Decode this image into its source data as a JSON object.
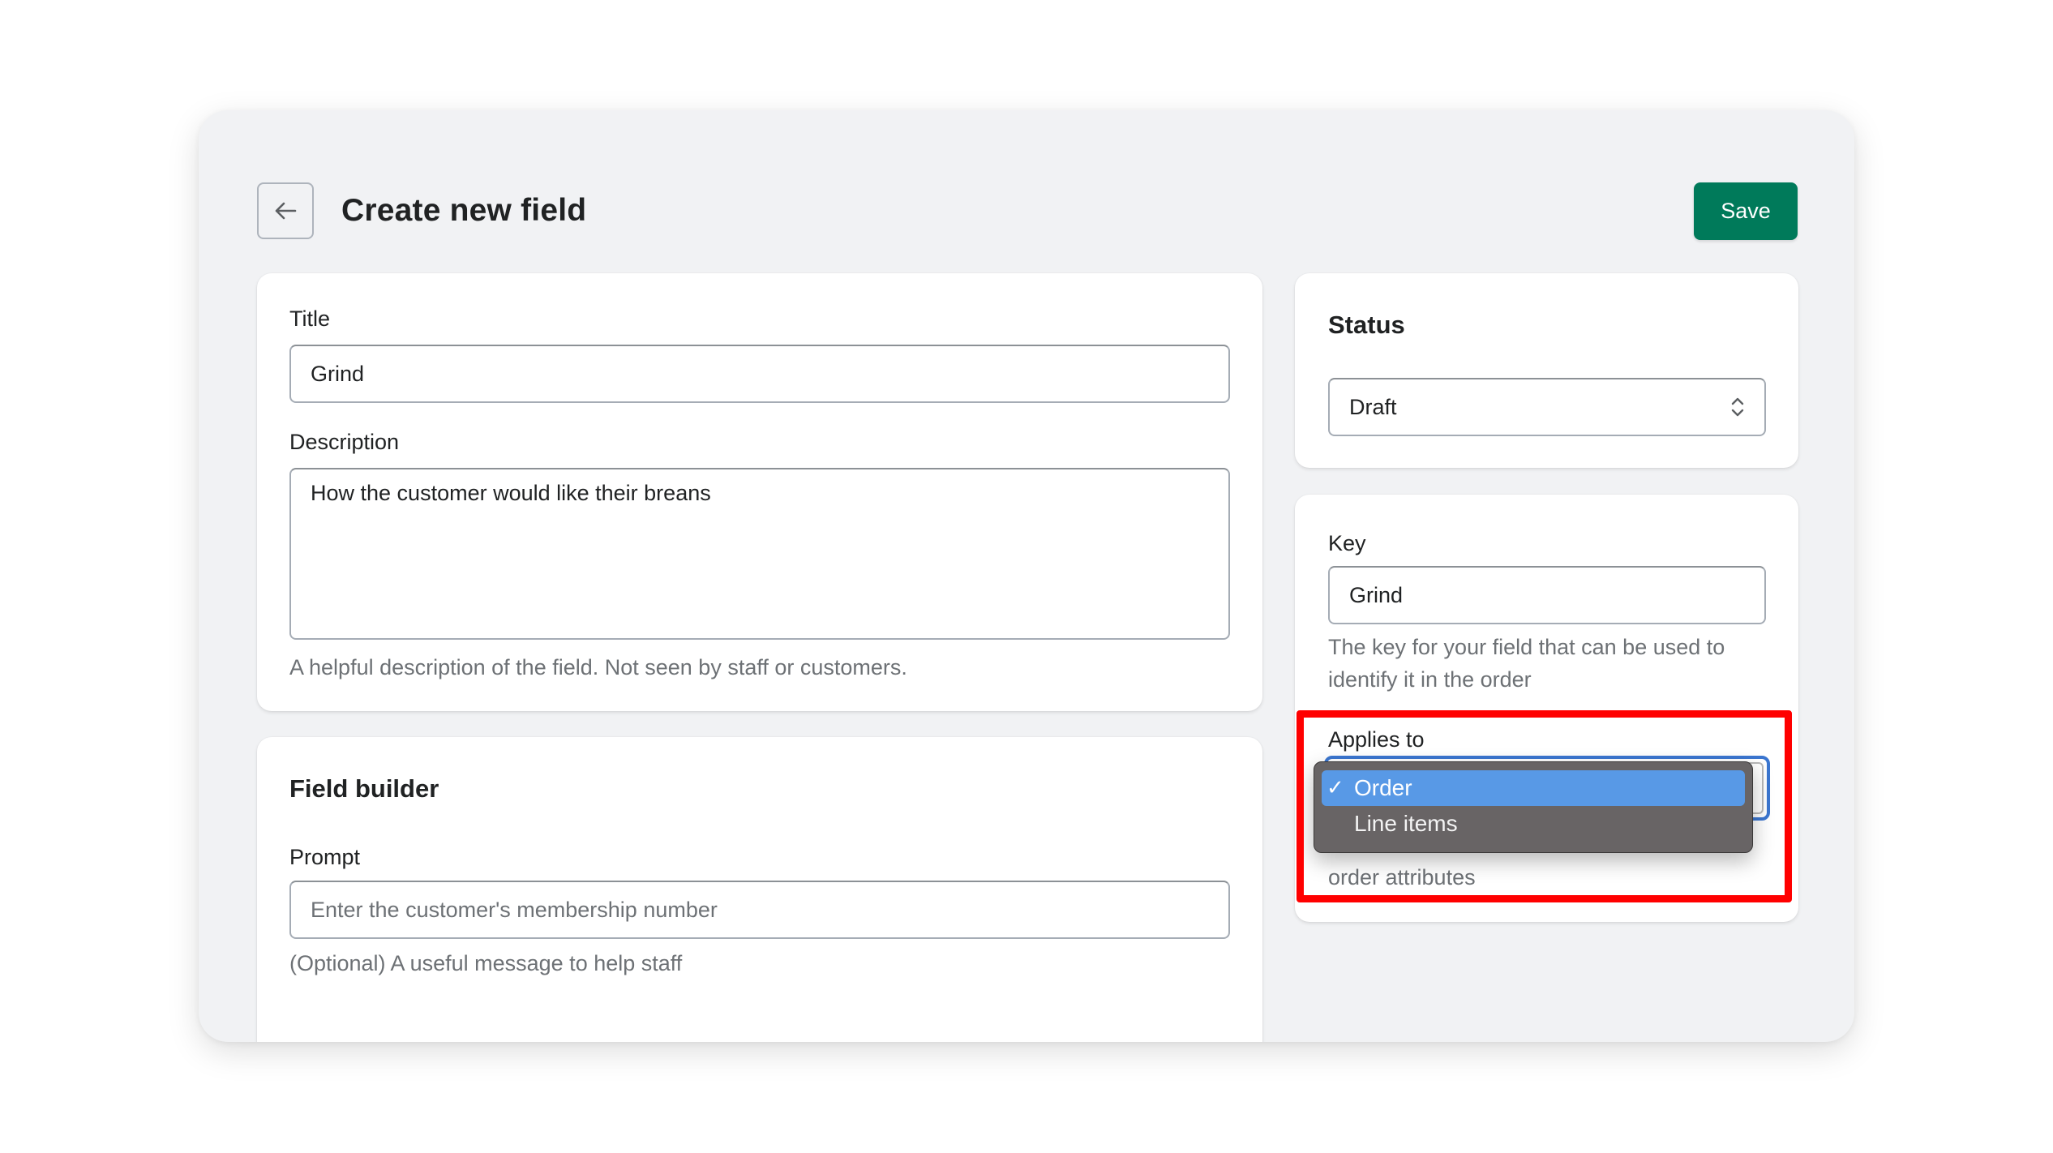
{
  "header": {
    "back_icon": "arrow-left-icon",
    "title": "Create new field",
    "save_label": "Save"
  },
  "details_card": {
    "title_label": "Title",
    "title_value": "Grind",
    "description_label": "Description",
    "description_value": "How the customer would like their breans",
    "description_help": "A helpful description of the field. Not seen by staff or customers."
  },
  "field_builder_card": {
    "heading": "Field builder",
    "prompt_label": "Prompt",
    "prompt_placeholder": "Enter the customer's membership number",
    "prompt_help": "(Optional) A useful message to help staff"
  },
  "status_card": {
    "heading": "Status",
    "selected": "Draft",
    "select_icon": "select-chevrons-icon"
  },
  "key_card": {
    "key_label": "Key",
    "key_value": "Grind",
    "key_help_line1": "The key for your field that can be used to",
    "key_help_line2": "identify it in the order",
    "applies_label": "Applies to",
    "applies_options": [
      {
        "label": "Order",
        "selected": true,
        "check": "✓"
      },
      {
        "label": "Line items",
        "selected": false
      }
    ],
    "applies_help_tail": "order attributes"
  },
  "colors": {
    "primary": "#007a5a",
    "highlight": "#ff0000",
    "menu_selected": "#5899e6",
    "focus_ring": "#3b76d0"
  }
}
